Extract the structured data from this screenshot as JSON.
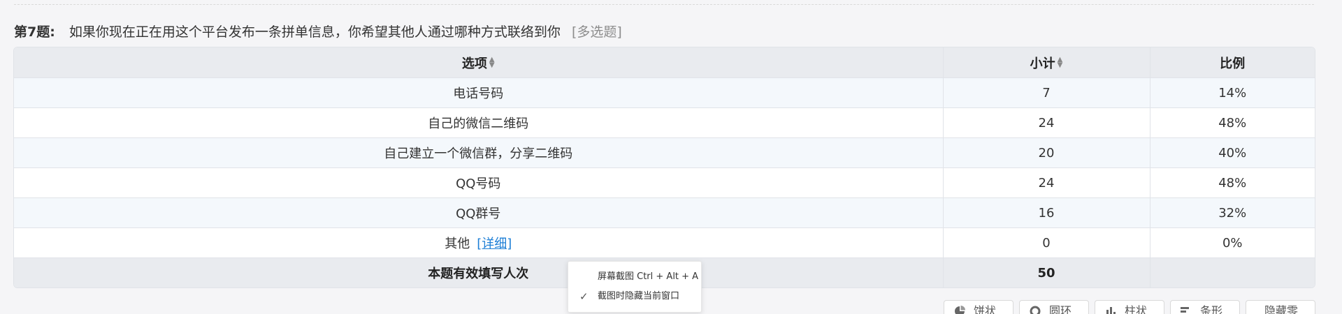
{
  "question": {
    "number": "第7题:",
    "text": "如果你现在正在用这个平台发布一条拼单信息，你希望其他人通过哪种方式联络到你",
    "type": "[多选题]"
  },
  "table": {
    "headers": {
      "option": "选项",
      "count": "小计",
      "ratio": "比例"
    },
    "rows": [
      {
        "option": "电话号码",
        "count": "7",
        "ratio": "14%"
      },
      {
        "option": "自己的微信二维码",
        "count": "24",
        "ratio": "48%"
      },
      {
        "option": "自己建立一个微信群，分享二维码",
        "count": "20",
        "ratio": "40%"
      },
      {
        "option": "QQ号码",
        "count": "24",
        "ratio": "48%"
      },
      {
        "option": "QQ群号",
        "count": "16",
        "ratio": "32%"
      },
      {
        "option": "其他",
        "count": "0",
        "ratio": "0%",
        "detail_link": "[详细]"
      }
    ],
    "total": {
      "label": "本题有效填写人次",
      "count": "50",
      "ratio": ""
    }
  },
  "context_menu": {
    "items": [
      {
        "label": "屏幕截图 Ctrl + Alt + A",
        "checked": false
      },
      {
        "label": "截图时隐藏当前窗口",
        "checked": true
      }
    ]
  },
  "chart_buttons": [
    {
      "label": "饼状",
      "icon": "pie-chart-icon"
    },
    {
      "label": "圆环",
      "icon": "donut-chart-icon"
    },
    {
      "label": "柱状",
      "icon": "bar-chart-icon"
    },
    {
      "label": "条形",
      "icon": "horizontal-bar-chart-icon"
    },
    {
      "label": "隐藏零",
      "icon": ""
    }
  ]
}
